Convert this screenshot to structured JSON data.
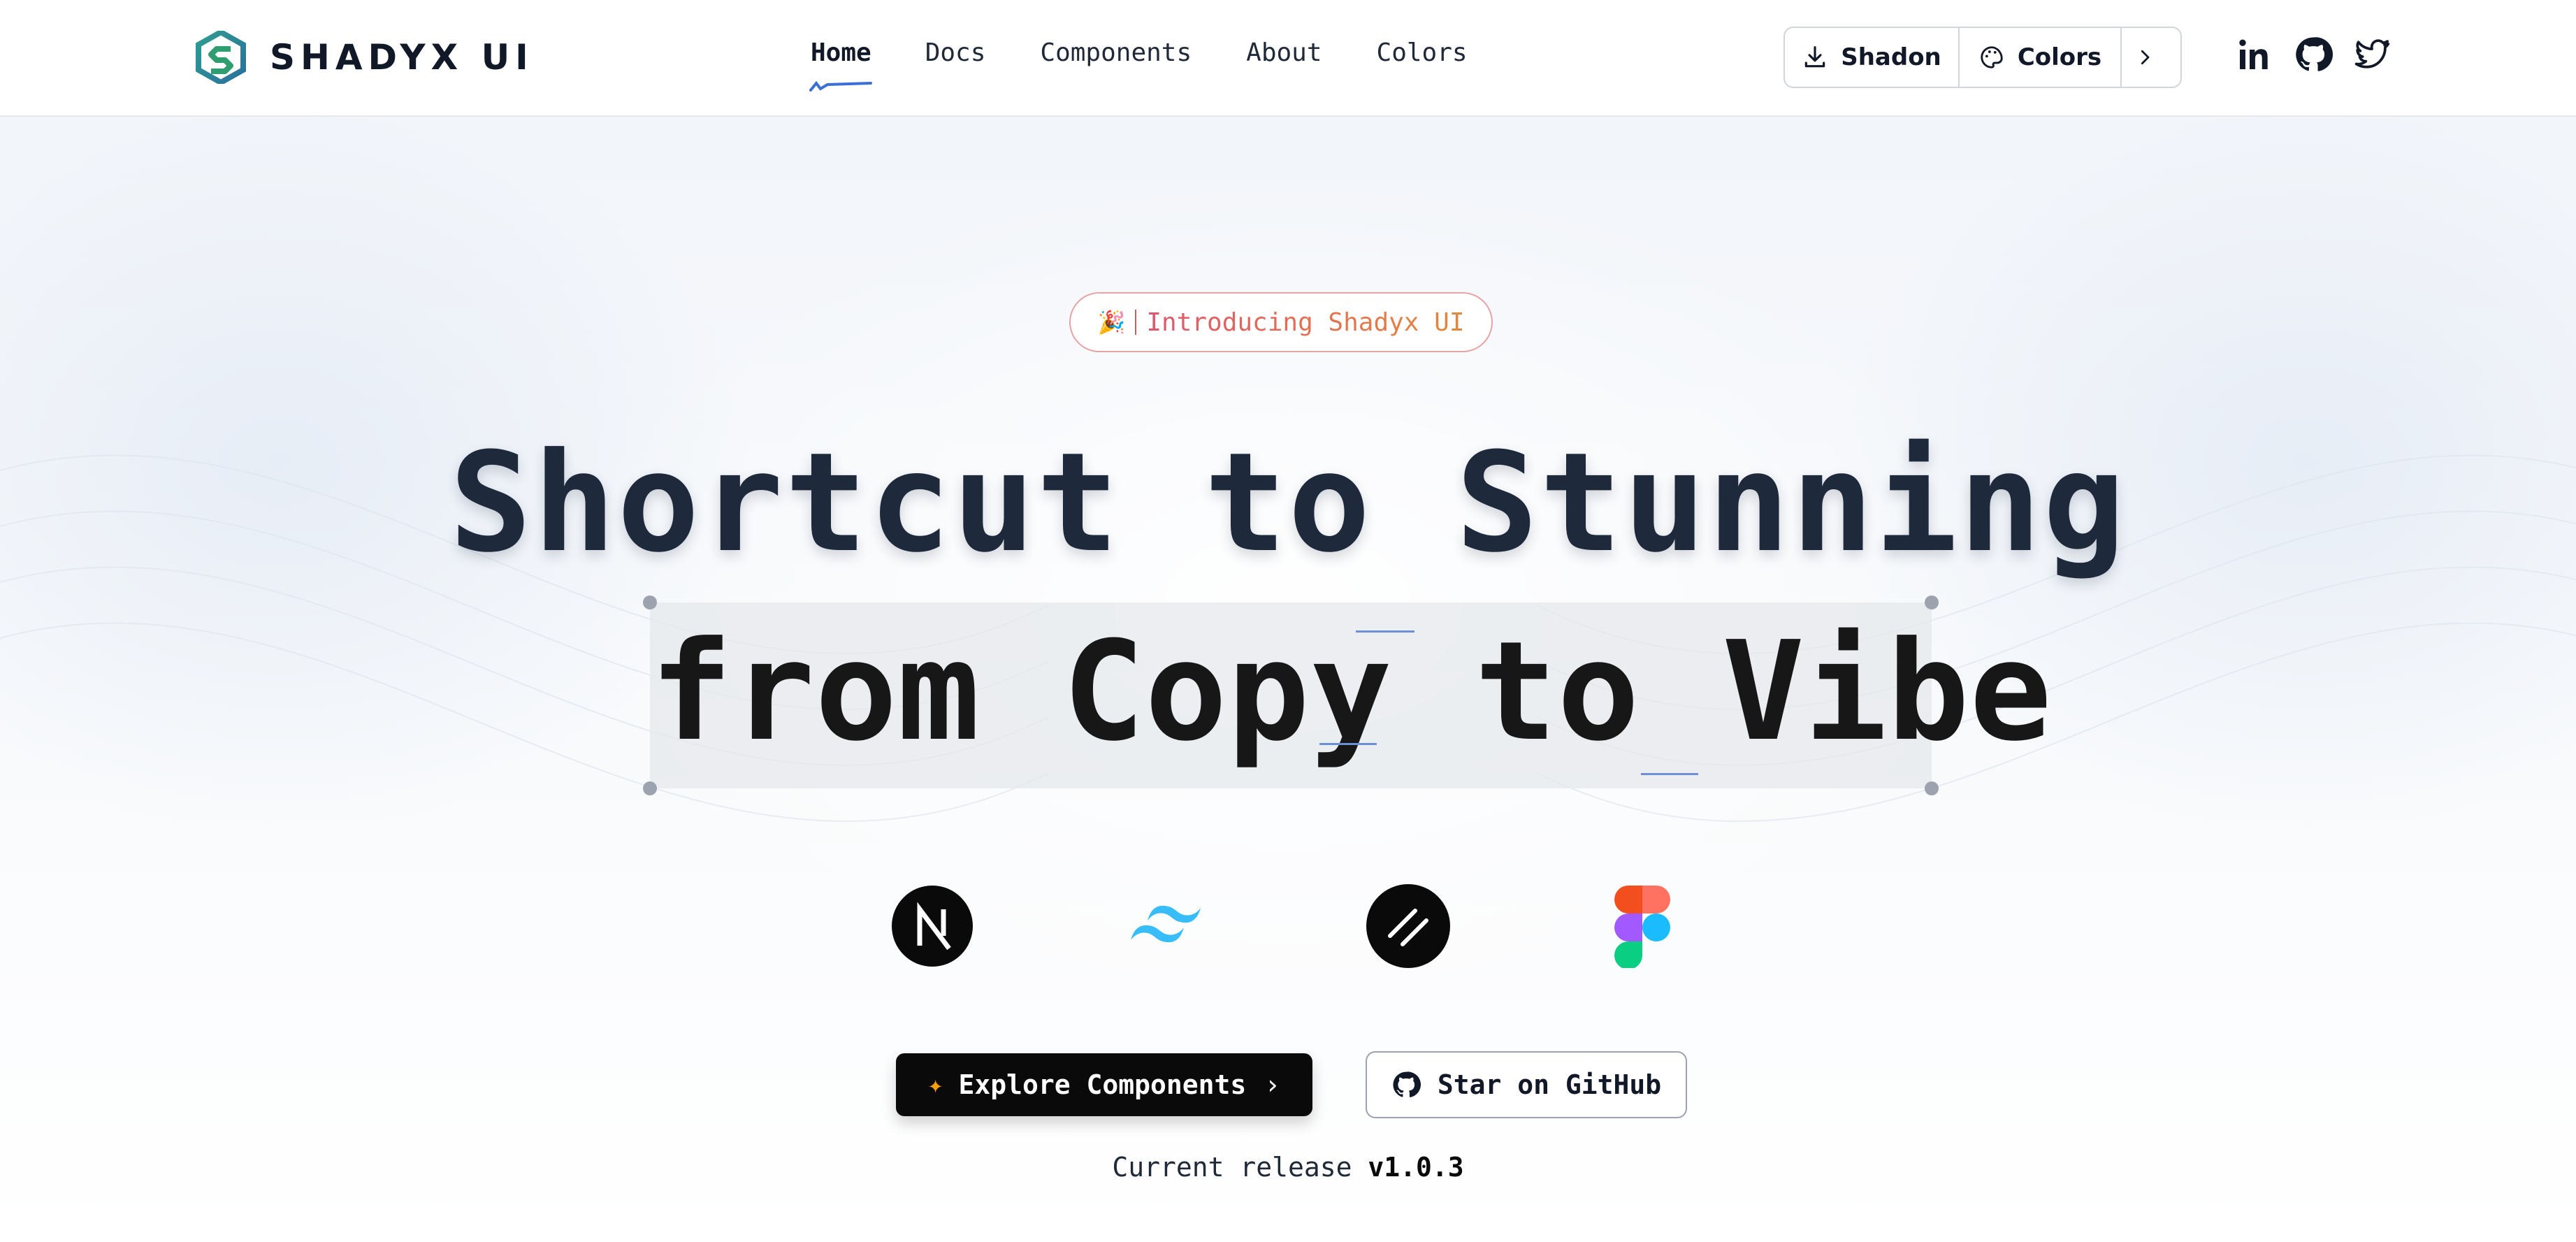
{
  "header": {
    "logo_text": "SHADYX UI",
    "nav": [
      {
        "label": "Home",
        "active": true
      },
      {
        "label": "Docs",
        "active": false
      },
      {
        "label": "Components",
        "active": false
      },
      {
        "label": "About",
        "active": false
      },
      {
        "label": "Colors",
        "active": false
      }
    ],
    "actions": {
      "shadon_label": "Shadon",
      "colors_label": "Colors",
      "more_icon": "chevron-right-icon"
    },
    "socials": [
      "linkedin-icon",
      "github-icon",
      "twitter-icon"
    ]
  },
  "hero": {
    "badge_emoji": "🎉",
    "badge_text": "Introducing Shadyx UI",
    "title_line1": "Shortcut to Stunning",
    "title_line2": "from Copy to Vibe",
    "tech_icons": [
      "nextjs-icon",
      "tailwind-icon",
      "shadcn-icon",
      "figma-icon"
    ],
    "primary_button": {
      "icon": "sparkles-icon",
      "label": "Explore Components",
      "chevron": "›"
    },
    "secondary_button": {
      "icon": "github-icon",
      "label": "Star on GitHub"
    },
    "release_prefix": "Current release",
    "release_version": "v1.0.3"
  },
  "colors": {
    "accent_blue": "#3b6fd6",
    "title": "#1e293b",
    "badge_border": "#e6a3a3",
    "button_dark": "#0a0a0a"
  }
}
